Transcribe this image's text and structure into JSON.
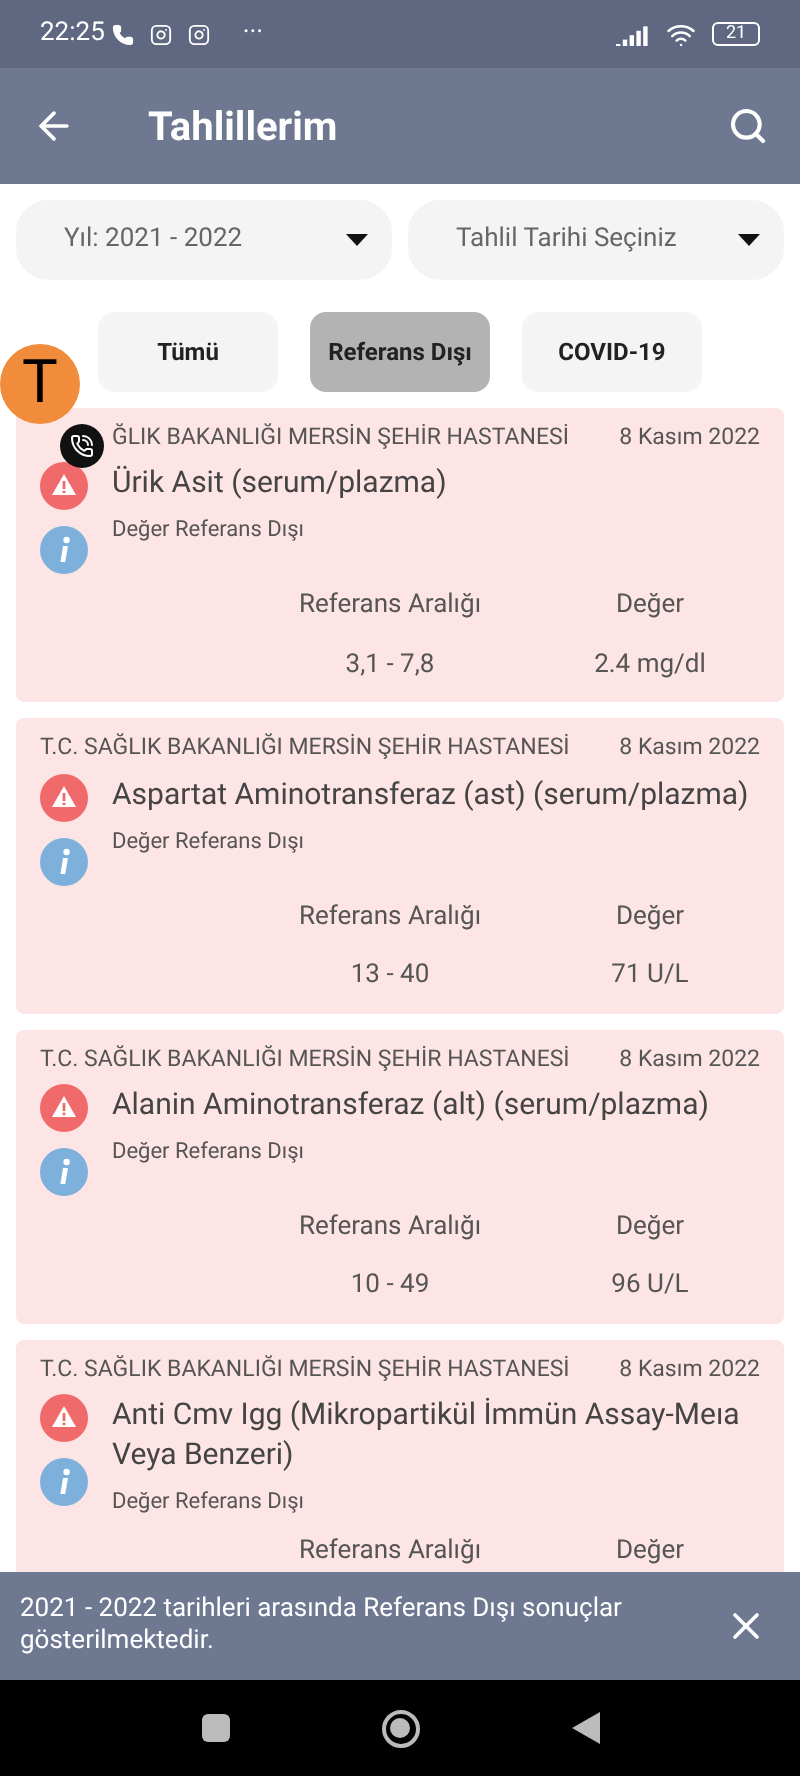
{
  "status_bar": {
    "time": "22:25",
    "more": "···",
    "battery": "21"
  },
  "app_bar": {
    "title": "Tahlillerim"
  },
  "filters": [
    {
      "label": "Yıl: 2021 - 2022"
    },
    {
      "label": "Tahlil Tarihi Seçiniz"
    }
  ],
  "tabs": [
    {
      "label": "Tümü",
      "selected": false
    },
    {
      "label": "Referans Dışı",
      "selected": true
    },
    {
      "label": "COVID-19",
      "selected": false
    }
  ],
  "chat_head": {
    "letter": "T"
  },
  "results": [
    {
      "hospital": "ĞLIK BAKANLIĞI MERSİN ŞEHİR HASTANESİ",
      "date": "8 Kasım 2022",
      "test": "Ürik Asit (serum/plazma)",
      "status": "Değer Referans Dışı",
      "range_label": "Referans Aralığı",
      "value_label": "Değer",
      "range": "3,1 - 7,8",
      "value": "2.4 mg/dl"
    },
    {
      "hospital": "T.C. SAĞLIK BAKANLIĞI MERSİN ŞEHİR HASTANESİ",
      "date": "8 Kasım 2022",
      "test": "Aspartat Aminotransferaz (ast) (serum/plazma)",
      "status": "Değer Referans Dışı",
      "range_label": "Referans Aralığı",
      "value_label": "Değer",
      "range": "13 - 40",
      "value": "71 U/L"
    },
    {
      "hospital": "T.C. SAĞLIK BAKANLIĞI MERSİN ŞEHİR HASTANESİ",
      "date": "8 Kasım 2022",
      "test": "Alanin Aminotransferaz (alt) (serum/plazma)",
      "status": "Değer Referans Dışı",
      "range_label": "Referans Aralığı",
      "value_label": "Değer",
      "range": "10 - 49",
      "value": "96 U/L"
    },
    {
      "hospital": "T.C. SAĞLIK BAKANLIĞI MERSİN ŞEHİR HASTANESİ",
      "date": "8 Kasım 2022",
      "test": "Anti Cmv Igg (Mikropartikül İmmün Assay-Meıa Veya Benzeri)",
      "status": "Değer Referans Dışı",
      "range_label": "Referans Aralığı",
      "value_label": "Değer"
    }
  ],
  "snackbar": {
    "message": "2021 - 2022 tarihleri arasında Referans Dışı sonuçlar gösterilmektedir."
  }
}
